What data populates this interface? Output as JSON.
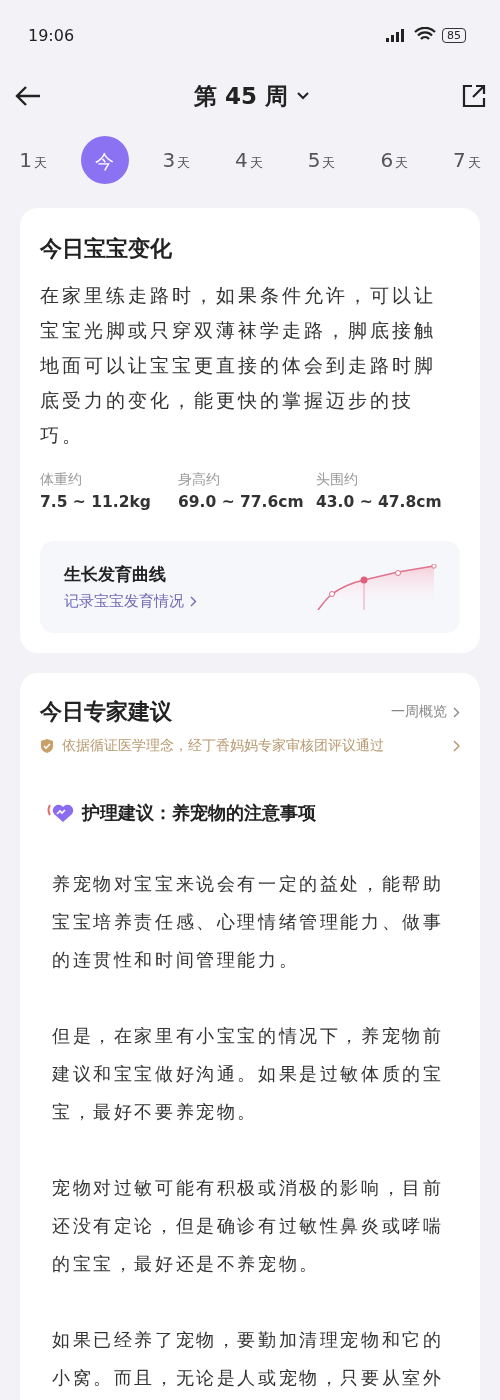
{
  "status_bar": {
    "time": "19:06",
    "battery": "85"
  },
  "header": {
    "title": "第 45 周"
  },
  "days": [
    {
      "number": "1",
      "unit": "天",
      "selected": false
    },
    {
      "number": "今",
      "selected": true
    },
    {
      "number": "3",
      "unit": "天",
      "selected": false
    },
    {
      "number": "4",
      "unit": "天",
      "selected": false
    },
    {
      "number": "5",
      "unit": "天",
      "selected": false
    },
    {
      "number": "6",
      "unit": "天",
      "selected": false
    },
    {
      "number": "7",
      "unit": "天",
      "selected": false
    }
  ],
  "baby_card": {
    "title": "今日宝宝变化",
    "text": "在家里练走路时，如果条件允许，可以让宝宝光脚或只穿双薄袜学走路，脚底接触地面可以让宝宝更直接的体会到走路时脚底受力的变化，能更快的掌握迈步的技巧。",
    "stats": [
      {
        "label": "体重约",
        "value": "7.5 ~ 11.2kg"
      },
      {
        "label": "身高约",
        "value": "69.0 ~ 77.6cm"
      },
      {
        "label": "头围约",
        "value": "43.0 ~ 47.8cm"
      }
    ],
    "growth": {
      "title": "生长发育曲线",
      "link": "记录宝宝发育情况"
    }
  },
  "expert_card": {
    "title": "今日专家建议",
    "overview": "一周概览",
    "notice": "依据循证医学理念，经丁香妈妈专家审核团评议通过",
    "topic": "护理建议：养宠物的注意事项",
    "paragraphs": [
      "养宠物对宝宝来说会有一定的益处，能帮助宝宝培养责任感、心理情绪管理能力、做事的连贯性和时间管理能力。",
      "但是，在家里有小宝宝的情况下，养宠物前建议和宝宝做好沟通。如果是过敏体质的宝宝，最好不要养宠物。",
      "宠物对过敏可能有积极或消极的影响，目前还没有定论，但是确诊有过敏性鼻炎或哮喘的宝宝，最好还是不养宠物。",
      "如果已经养了宠物，要勤加清理宠物和它的小窝。而且，无论是人或宠物，只要从室外"
    ]
  }
}
